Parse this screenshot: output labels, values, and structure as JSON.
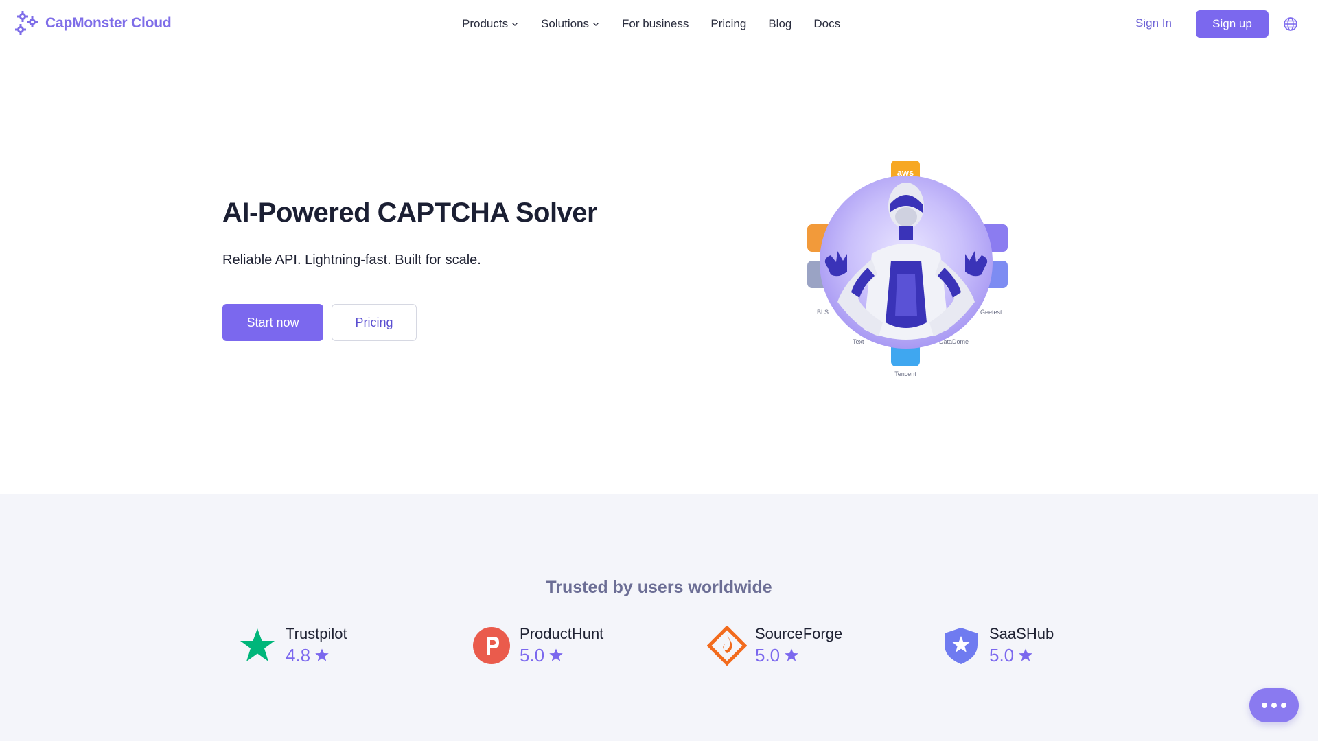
{
  "brand": {
    "name": "CapMonster Cloud",
    "color": "#7e6de8"
  },
  "nav": {
    "items": [
      {
        "label": "Products",
        "dropdown": true
      },
      {
        "label": "Solutions",
        "dropdown": true
      },
      {
        "label": "For business",
        "dropdown": false
      },
      {
        "label": "Pricing",
        "dropdown": false
      },
      {
        "label": "Blog",
        "dropdown": false
      },
      {
        "label": "Docs",
        "dropdown": false
      }
    ],
    "sign_in": "Sign In",
    "sign_up": "Sign up",
    "language_icon": "globe-icon"
  },
  "hero": {
    "title": "AI-Powered CAPTCHA Solver",
    "subtitle": "Reliable API. Lightning-fast. Built for scale.",
    "primary_cta": "Start now",
    "secondary_cta": "Pricing",
    "illustration_labels": {
      "aws": "aws",
      "bls": "BLS",
      "geetest": "Geetest",
      "text": "Text",
      "datadome": "DataDome",
      "tencent": "Tencent"
    }
  },
  "trusted": {
    "title": "Trusted by users worldwide",
    "reviews": [
      {
        "name": "Trustpilot",
        "score": "4.8",
        "icon": "trustpilot-star-icon",
        "color": "#00b67a"
      },
      {
        "name": "ProductHunt",
        "score": "5.0",
        "icon": "producthunt-icon",
        "color": "#ea5b4c"
      },
      {
        "name": "SourceForge",
        "score": "5.0",
        "icon": "sourceforge-icon",
        "color": "#f26b1d"
      },
      {
        "name": "SaaSHub",
        "score": "5.0",
        "icon": "saashub-shield-icon",
        "color": "#6f7bf0"
      }
    ]
  },
  "colors": {
    "accent": "#7b68ee",
    "section_bg": "#f4f5fa"
  },
  "chat": {
    "icon": "chat-dots-icon"
  }
}
